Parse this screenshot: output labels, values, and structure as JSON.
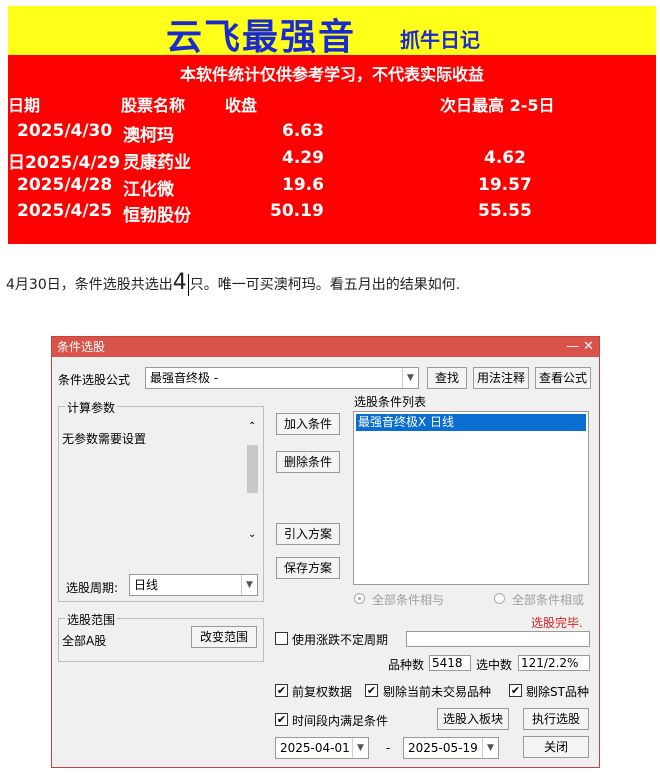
{
  "banner": {
    "title": "云飞最强音",
    "subtitle": "抓牛日记",
    "disclaimer": "本软件统计仅供参考学习，不代表实际收益",
    "headers": {
      "date": "日期",
      "name": "股票名称",
      "close": "收盘",
      "next_high": "次日最高 2-5日"
    },
    "rows": [
      {
        "date": "2025/4/30",
        "name": "澳柯玛",
        "close": "6.63",
        "next_high": ""
      },
      {
        "date": "日2025/4/29",
        "name": "灵康药业",
        "close": "4.29",
        "next_high": "4.62"
      },
      {
        "date": "2025/4/28",
        "name": "江化微",
        "close": "19.6",
        "next_high": "19.57"
      },
      {
        "date": "2025/4/25",
        "name": "恒勃股份",
        "close": "50.19",
        "next_high": "55.55"
      }
    ]
  },
  "note": {
    "before": "4月30日，条件选股共选出",
    "big": "4",
    "after": "只。唯一可买澳柯玛。看五月出的结果如何."
  },
  "dialog": {
    "title": "条件选股",
    "minimize": "—",
    "close": "✕",
    "formula_label": "条件选股公式",
    "formula_value": "最强音终极  -",
    "find": "查找",
    "usage": "用法注释",
    "view_formula": "查看公式",
    "params_group": "计算参数",
    "params_text": "无参数需要设置",
    "period_label": "选股周期:",
    "period_value": "日线",
    "add_condition": "加入条件",
    "delete_condition": "删除条件",
    "import_plan": "引入方案",
    "save_plan": "保存方案",
    "list_label": "选股条件列表",
    "list_items": [
      "最强音终极X  日线"
    ],
    "radio_and": "全部条件相与",
    "radio_or": "全部条件相或",
    "status": "选股完毕.",
    "scope_group": "选股范围",
    "scope_value": "全部A股",
    "change_scope": "改变范围",
    "use_volatile": "使用涨跌不定周期",
    "count_label": "品种数",
    "count_value": "5418",
    "selected_label": "选中数",
    "selected_value": "121/2.2%",
    "pre_adjust": "前复权数据",
    "exclude_untraded": "剔除当前未交易品种",
    "exclude_st": "剔除ST品种",
    "time_range": "时间段内满足条件",
    "select_to_block": "选股入板块",
    "execute": "执行选股",
    "date_from": "2025-04-01",
    "date_sep": "-",
    "date_to": "2025-05-19",
    "close_btn": "关闭",
    "colors": {
      "titlebar": "#d9534a",
      "selected": "#0a6ed1",
      "status": "#e02020"
    }
  }
}
